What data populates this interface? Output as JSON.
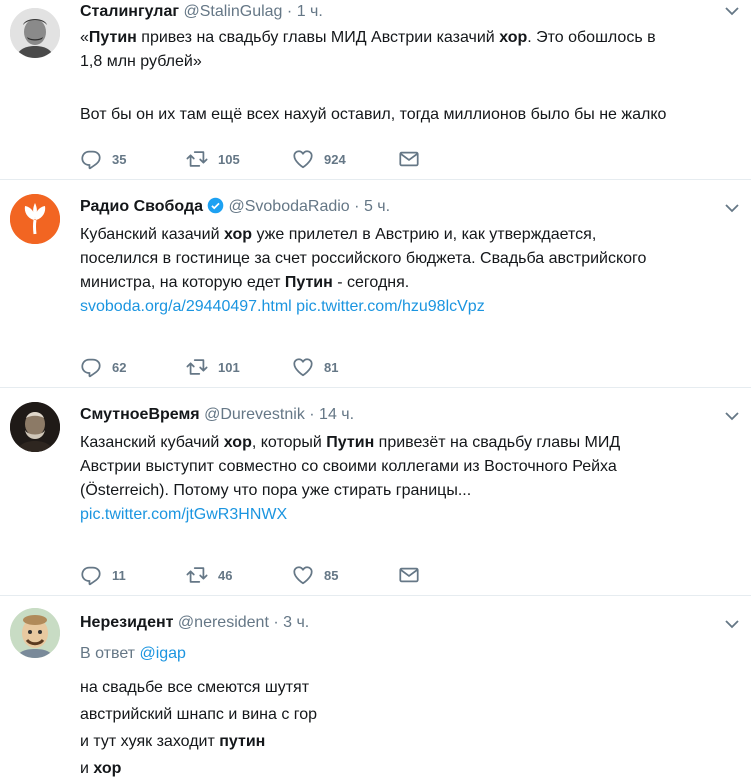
{
  "tweets": [
    {
      "name": "Сталингулаг",
      "handle": "@StalinGulag",
      "sep": "·",
      "time": "1 ч.",
      "line1_a": "«",
      "line1_b": "Путин",
      "line1_c": " привез на свадьбу главы МИД Австрии казачий ",
      "line1_d": "хор",
      "line1_e": ". Это обошлось в",
      "line2": "1,8 млн рублей»",
      "line3": "Вот бы он их там ещё всех нахуй оставил, тогда миллионов было бы не жалко",
      "replies": "35",
      "retweets": "105",
      "likes": "924"
    },
    {
      "name": "Радио Свобода",
      "handle": "@SvobodaRadio",
      "sep": "·",
      "time": "5 ч.",
      "line1_a": "Кубанский казачий ",
      "line1_b": "хор",
      "line1_c": " уже прилетел в Австрию и, как утверждается,",
      "line2": "поселился в гостинице за счет российского бюджета. Свадьба австрийского",
      "line3_a": "министра, на которую едет ",
      "line3_b": "Путин",
      "line3_c": " - сегодня.",
      "link1": "svoboda.org/a/29440497.html",
      "link2": "pic.twitter.com/hzu98lcVpz",
      "replies": "62",
      "retweets": "101",
      "likes": "81"
    },
    {
      "name": "СмутноеВремя",
      "handle": "@Durevestnik",
      "sep": "·",
      "time": "14 ч.",
      "line1_a": "Казанский кубачий ",
      "line1_b": "хор",
      "line1_c": ", который ",
      "line1_d": "Путин",
      "line1_e": " привезёт на свадьбу главы МИД",
      "line2": "Австрии выступит совместно со своими коллегами из Восточного Рейха",
      "line3": "(Österreich). Потому что пора уже стирать границы...",
      "link": "pic.twitter.com/jtGwR3HNWX",
      "replies": "11",
      "retweets": "46",
      "likes": "85"
    },
    {
      "name": "Нерезидент",
      "handle": "@neresident",
      "sep": "·",
      "time": "3 ч.",
      "reply_prefix": "В ответ ",
      "reply_handle": "@igap",
      "line1": "на свадьбе все смеются шутят",
      "line2": "австрийский шнапс и вина с гор",
      "line3_a": "и тут хуяк заходит ",
      "line3_b": "путин",
      "line4_a": "и ",
      "line4_b": "хор"
    }
  ],
  "colors": {
    "link": "#1b95e0",
    "muted": "#657786",
    "svoboda": "#f26522",
    "verified": "#1da1f2"
  }
}
